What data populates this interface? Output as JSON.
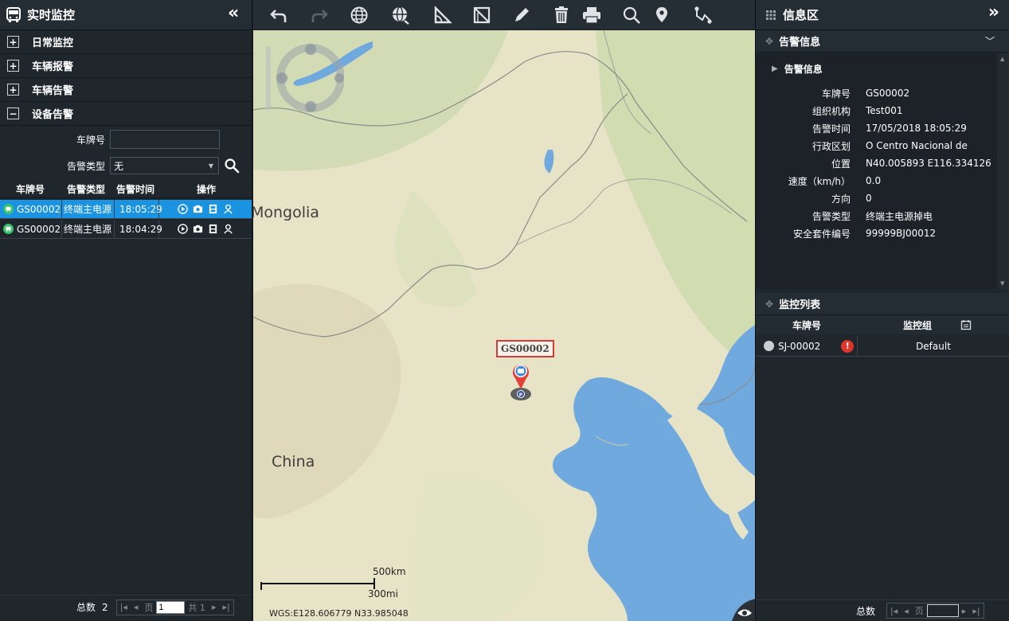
{
  "left_panel": {
    "title": "实时监控",
    "collapse_icon": "«",
    "sections": [
      {
        "label": "日常监控",
        "state": "+"
      },
      {
        "label": "车辆报警",
        "state": "+"
      },
      {
        "label": "车辆告警",
        "state": "+"
      },
      {
        "label": "设备告警",
        "state": "−"
      }
    ],
    "form": {
      "plate_label": "车牌号",
      "plate_value": "",
      "alarm_type_label": "告警类型",
      "alarm_type_value": "无"
    },
    "table": {
      "headers": [
        "车牌号",
        "告警类型",
        "告警时间",
        "操作"
      ],
      "rows": [
        {
          "plate": "GS00002",
          "type": "终端主电源",
          "time": "18:05:29",
          "selected": true
        },
        {
          "plate": "GS00002",
          "type": "终端主电源",
          "time": "18:04:29",
          "selected": false
        }
      ]
    },
    "footer": {
      "total_label": "总数",
      "total": "2",
      "page_label": "页",
      "page": "1",
      "of_label": "共 1"
    }
  },
  "map": {
    "labels": {
      "mongolia": "Mongolia",
      "china": "China"
    },
    "vehicle_tag": "GS00002",
    "scale_km": "500km",
    "scale_mi": "300mi",
    "coords": "WGS:E128.606779  N33.985048"
  },
  "right_panel": {
    "title": "信息区",
    "expand_icon": "»",
    "alarm_section_title": "告警信息",
    "alarm_sub_title": "告警信息",
    "info": [
      {
        "k": "车牌号",
        "v": "GS00002"
      },
      {
        "k": "组织机构",
        "v": "Test001"
      },
      {
        "k": "告警时间",
        "v": "17/05/2018 18:05:29"
      },
      {
        "k": "行政区划",
        "v": "O Centro Nacional de"
      },
      {
        "k": "位置",
        "v": "N40.005893 E116.334126"
      },
      {
        "k": "速度（km/h）",
        "v": "0.0"
      },
      {
        "k": "方向",
        "v": "0"
      },
      {
        "k": "告警类型",
        "v": "终端主电源掉电"
      },
      {
        "k": "安全套件编号",
        "v": "99999BJ00012"
      }
    ],
    "monitor_section_title": "监控列表",
    "monitor_headers": [
      "车牌号",
      "监控组"
    ],
    "monitor_rows": [
      {
        "plate": "SJ-00002",
        "alert": "!",
        "group": "Default"
      }
    ],
    "footer": {
      "total_label": "总数",
      "page_label": "页",
      "page": ""
    }
  },
  "colors": {
    "selected_row": "#1a94e0",
    "alert": "#e0352b",
    "status_green": "#39c46b",
    "tag_border": "#d83a3a"
  }
}
